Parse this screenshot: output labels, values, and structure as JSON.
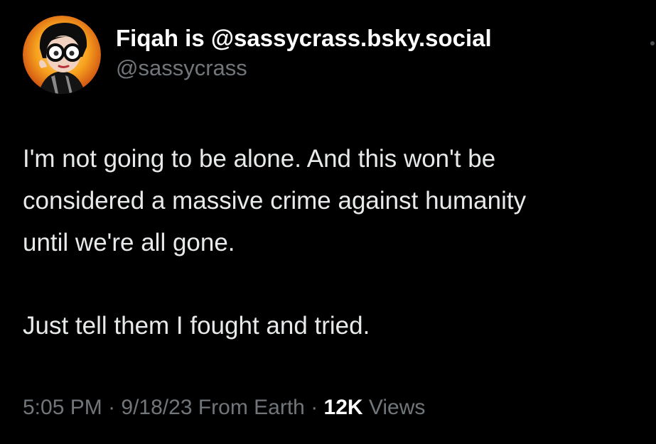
{
  "author": {
    "display_name": "Fiqah is @sassycrass.bsky.social",
    "handle": "@sassycrass",
    "avatar_icon": "edna-mode-avatar-icon"
  },
  "post": {
    "lines": [
      "I'm not going to be alone. And this won't be",
      "considered a massive crime against humanity",
      "until we're all gone."
    ],
    "closing_line": "Just tell them I fought and tried."
  },
  "meta": {
    "time": "5:05 PM",
    "separator_1": " · ",
    "date": "9/18/23",
    "location": " From Earth",
    "separator_2": " · ",
    "views_count": "12K",
    "views_label": " Views"
  },
  "colors": {
    "background": "#000000",
    "primary_text": "#e7e9ea",
    "secondary_text": "#71767b",
    "avatar_ring": "#f59a1b"
  }
}
